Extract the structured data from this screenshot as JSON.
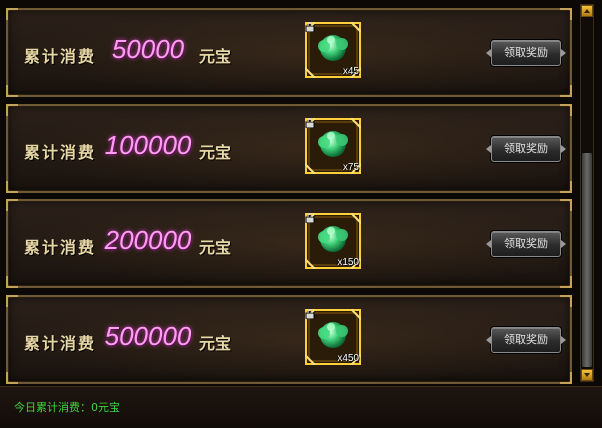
{
  "rows": [
    {
      "label": "累计消费",
      "amount": "50000",
      "unit": "元宝",
      "quantity": "x45",
      "button": "领取奖励",
      "item_icon": "jade-icon"
    },
    {
      "label": "累计消费",
      "amount": "100000",
      "unit": "元宝",
      "quantity": "x75",
      "button": "领取奖励",
      "item_icon": "jade-icon"
    },
    {
      "label": "累计消费",
      "amount": "200000",
      "unit": "元宝",
      "quantity": "x150",
      "button": "领取奖励",
      "item_icon": "jade-icon"
    },
    {
      "label": "累计消费",
      "amount": "500000",
      "unit": "元宝",
      "quantity": "x450",
      "button": "领取奖励",
      "item_icon": "jade-icon"
    }
  ],
  "footer": {
    "text": "今日累计消费：0元宝"
  },
  "colors": {
    "amount": "#ff9ef0",
    "label": "#e6d7a4",
    "footer": "#3fd23c",
    "frame": "#c4a25a"
  }
}
